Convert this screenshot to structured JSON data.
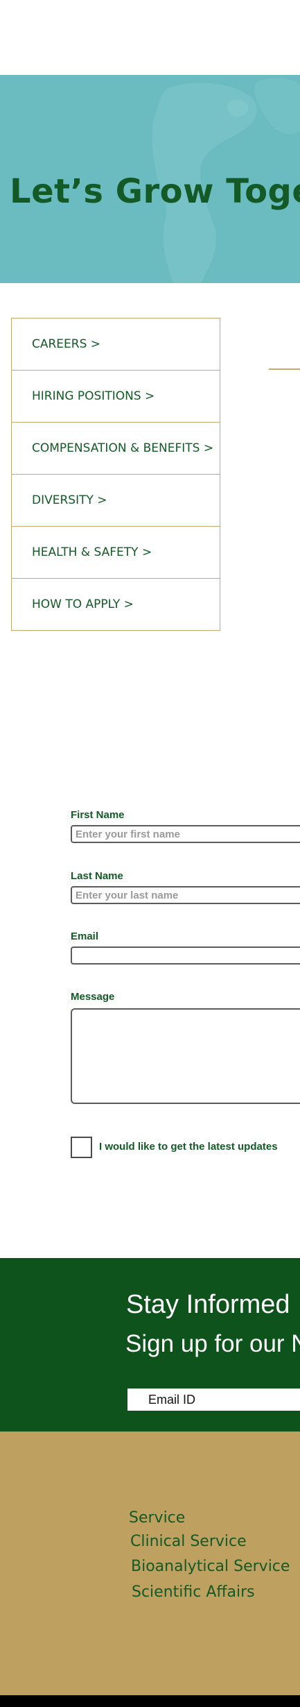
{
  "hero": {
    "title": "Let’s Grow Together"
  },
  "menu": {
    "items": [
      {
        "label": "CAREERS  >"
      },
      {
        "label": "HIRING POSITIONS >"
      },
      {
        "label": "COMPENSATION & BENEFITS  >"
      },
      {
        "label": "DIVERSITY  >"
      },
      {
        "label": "HEALTH & SAFETY  >"
      },
      {
        "label": "HOW TO APPLY  >"
      }
    ]
  },
  "form": {
    "first_name_label": "First Name",
    "first_name_placeholder": "Enter your first name",
    "last_name_label": "Last Name",
    "last_name_placeholder": "Enter your last name",
    "email_label": "Email",
    "message_label": "Message",
    "updates_label": "I would like to get the latest updates"
  },
  "newsletter": {
    "title": "Stay Informed",
    "subtitle": "Sign up for our Newsletter",
    "email_placeholder": "Email ID"
  },
  "footer_links": [
    {
      "label": "Service"
    },
    {
      "label": "Clinical Service"
    },
    {
      "label": "Bioanalytical Service"
    },
    {
      "label": "Scientific Affairs"
    }
  ],
  "colors": {
    "hero_bg": "#6bbcc1",
    "brand_green": "#135a26",
    "newsletter_bg": "#0e521c",
    "footer_gold": "#bea060",
    "accent_gold": "#c9a86a"
  }
}
